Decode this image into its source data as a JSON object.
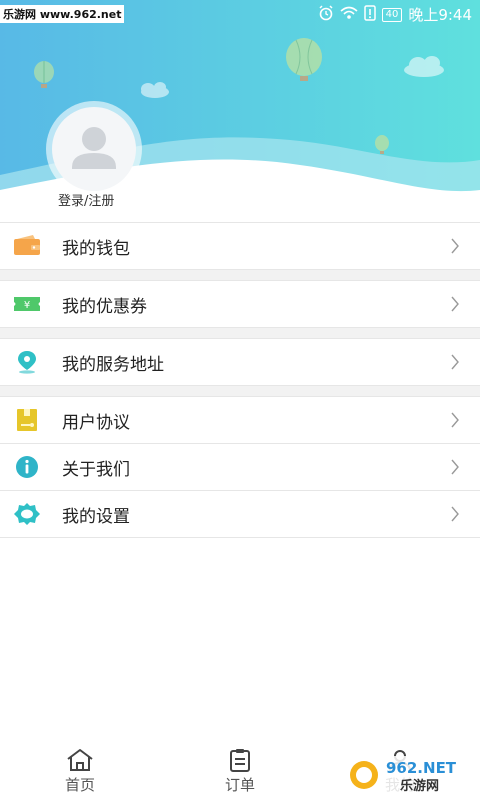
{
  "status": {
    "watermark": "乐游网 www.962.net",
    "battery": "40",
    "time": "晚上9:44"
  },
  "profile": {
    "login_label": "登录/注册"
  },
  "menu": [
    {
      "label": "我的钱包",
      "icon": "wallet-icon",
      "color": "#f5a54a"
    },
    {
      "label": "我的优惠券",
      "icon": "coupon-icon",
      "color": "#4fc86a"
    },
    {
      "label": "我的服务地址",
      "icon": "location-icon",
      "color": "#2fc0c6"
    },
    {
      "label": "用户协议",
      "icon": "agreement-icon",
      "color": "#e6c62a"
    },
    {
      "label": "关于我们",
      "icon": "info-icon",
      "color": "#2fb4c8"
    },
    {
      "label": "我的设置",
      "icon": "gear-icon",
      "color": "#2fc0c6"
    }
  ],
  "tabs": [
    {
      "label": "首页",
      "icon": "home-icon"
    },
    {
      "label": "订单",
      "icon": "order-icon"
    },
    {
      "label": "我的",
      "icon": "profile-icon"
    }
  ],
  "watermark_bottom": {
    "line1": "962.NET",
    "line2": "乐游网"
  }
}
